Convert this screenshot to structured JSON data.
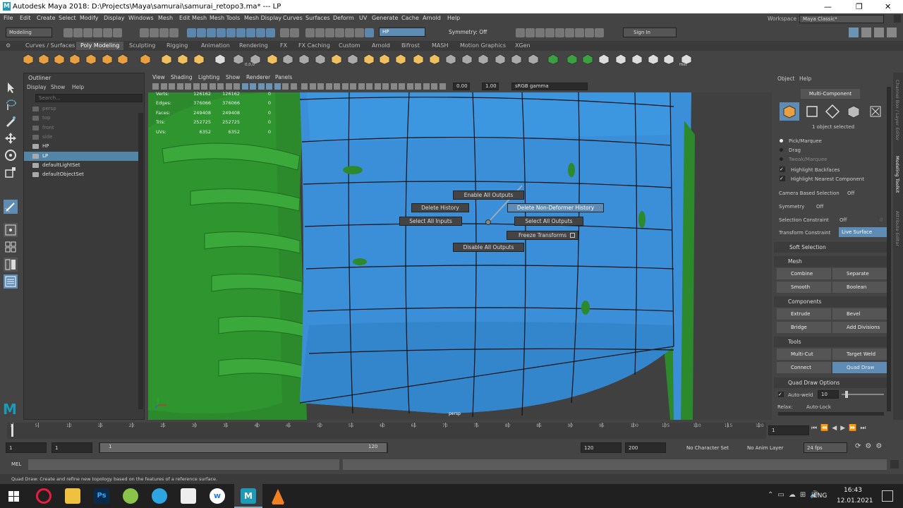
{
  "window": {
    "title": "Autodesk Maya 2018: D:\\Projects\\Maya\\samurai\\samurai_retopo3.ma*   ---   LP",
    "logo_letter": "M"
  },
  "menus": [
    "File",
    "Edit",
    "Create",
    "Select",
    "Modify",
    "Display",
    "Windows",
    "Mesh",
    "Edit Mesh",
    "Mesh Tools",
    "Mesh Display",
    "Curves",
    "Surfaces",
    "Deform",
    "UV",
    "Generate",
    "Cache",
    "Arnold",
    "Help"
  ],
  "workspace": {
    "label": "Workspace :",
    "value": "Maya Classic*"
  },
  "statusline": {
    "mode": "Modeling",
    "live_object": "HP",
    "symmetry": "Symmetry: Off",
    "sign_in": "Sign In"
  },
  "shelf_tabs": [
    "Curves / Surfaces",
    "Poly Modeling",
    "Sculpting",
    "Rigging",
    "Animation",
    "Rendering",
    "FX",
    "FX Caching",
    "Custom",
    "Arnold",
    "Bifrost",
    "MASH",
    "Motion Graphics",
    "XGen"
  ],
  "shelf_active": "Poly Modeling",
  "shelf_hist_label": "Hist",
  "shelf_zero_label": "0,0,0",
  "outliner": {
    "title": "Outliner",
    "menus": [
      "Display",
      "Show",
      "Help"
    ],
    "search_placeholder": "Search...",
    "items": [
      {
        "label": "persp",
        "state": "dim"
      },
      {
        "label": "top",
        "state": "dim"
      },
      {
        "label": "front",
        "state": "dim"
      },
      {
        "label": "side",
        "state": "dim"
      },
      {
        "label": "HP",
        "state": "normal"
      },
      {
        "label": "LP",
        "state": "sel"
      },
      {
        "label": "defaultLightSet",
        "state": "normal"
      },
      {
        "label": "defaultObjectSet",
        "state": "normal"
      }
    ]
  },
  "viewport": {
    "menus": [
      "View",
      "Shading",
      "Lighting",
      "Show",
      "Renderer",
      "Panels"
    ],
    "exposure": "0.00",
    "gamma": "1.00",
    "color_space": "sRGB gamma",
    "camera_label": "persp",
    "hud": [
      {
        "label": "Verts:",
        "a": "126162",
        "b": "126162",
        "c": "0"
      },
      {
        "label": "Edges:",
        "a": "376066",
        "b": "376066",
        "c": "0"
      },
      {
        "label": "Faces:",
        "a": "249408",
        "b": "249408",
        "c": "0"
      },
      {
        "label": "Tris:",
        "a": "252725",
        "b": "252725",
        "c": "0"
      },
      {
        "label": "UVs:",
        "a": "6352",
        "b": "6352",
        "c": "0"
      }
    ],
    "marking_menu": {
      "enable_all_outputs": "Enable All Outputs",
      "delete_history": "Delete History",
      "delete_non_deformer_history": "Delete Non-Deformer History",
      "select_all_inputs": "Select All Inputs",
      "select_all_outputs": "Select All Outputs",
      "freeze_transforms": "Freeze Transforms",
      "disable_all_outputs": "Disable All Outputs"
    }
  },
  "modeling_toolkit": {
    "menus": [
      "Object",
      "Help"
    ],
    "mode": "Multi-Component",
    "selected": "1 object selected",
    "pick_marquee": "Pick/Marquee",
    "drag": "Drag",
    "tweak_marquee": "Tweak/Marquee",
    "highlight_backfaces": "Highlight Backfaces",
    "highlight_nearest": "Highlight Nearest Component",
    "camera_based_selection": {
      "label": "Camera Based Selection",
      "value": "Off"
    },
    "symmetry": {
      "label": "Symmetry",
      "value": "Off"
    },
    "selection_constraint": {
      "label": "Selection Constraint",
      "value": "Off",
      "num": "0"
    },
    "transform_constraint": {
      "label": "Transform Constraint",
      "value": "Live Surface"
    },
    "soft_selection": "Soft Selection",
    "mesh_header": "Mesh",
    "mesh": [
      "Combine",
      "Separate",
      "Smooth",
      "Boolean"
    ],
    "components_header": "Components",
    "components": [
      "Extrude",
      "Bevel",
      "Bridge",
      "Add Divisions"
    ],
    "tools_header": "Tools",
    "tools": [
      "Multi-Cut",
      "Target Weld",
      "Connect",
      "Quad Draw"
    ],
    "quad_draw_options": "Quad Draw Options",
    "auto_weld": {
      "label": "Auto-weld",
      "value": "10"
    },
    "relax": {
      "label": "Relax:",
      "value": "Auto-Lock"
    }
  },
  "side_tabs": [
    "Channel Box / Layer Editor",
    "Modeling Toolkit",
    "Attribute Editor"
  ],
  "timeline": {
    "ticks": [
      "1",
      "5",
      "10",
      "15",
      "20",
      "25",
      "30",
      "35",
      "40",
      "45",
      "50",
      "55",
      "60",
      "65",
      "70",
      "75",
      "80",
      "85",
      "90",
      "95",
      "100",
      "105",
      "110",
      "115",
      "120"
    ],
    "current_frame": "1"
  },
  "range": {
    "start": "1",
    "playback_start": "1",
    "slider_start": "1",
    "slider_end": "120",
    "playback_end": "120",
    "end": "200",
    "character_set": "No Character Set",
    "anim_layer": "No Anim Layer",
    "fps": "24 fps"
  },
  "command_line": {
    "label": "MEL"
  },
  "help_line": "Quad Draw: Create and refine new topology based on the features of a reference surface.",
  "taskbar": {
    "lang": "ENG",
    "time": "16:43",
    "date": "12.01.2021"
  },
  "colors": {
    "mesh_blue": "#3a8fd8",
    "mesh_green": "#2e8b2e",
    "selection": "#5285a6",
    "accent": "#5e8cb4"
  }
}
